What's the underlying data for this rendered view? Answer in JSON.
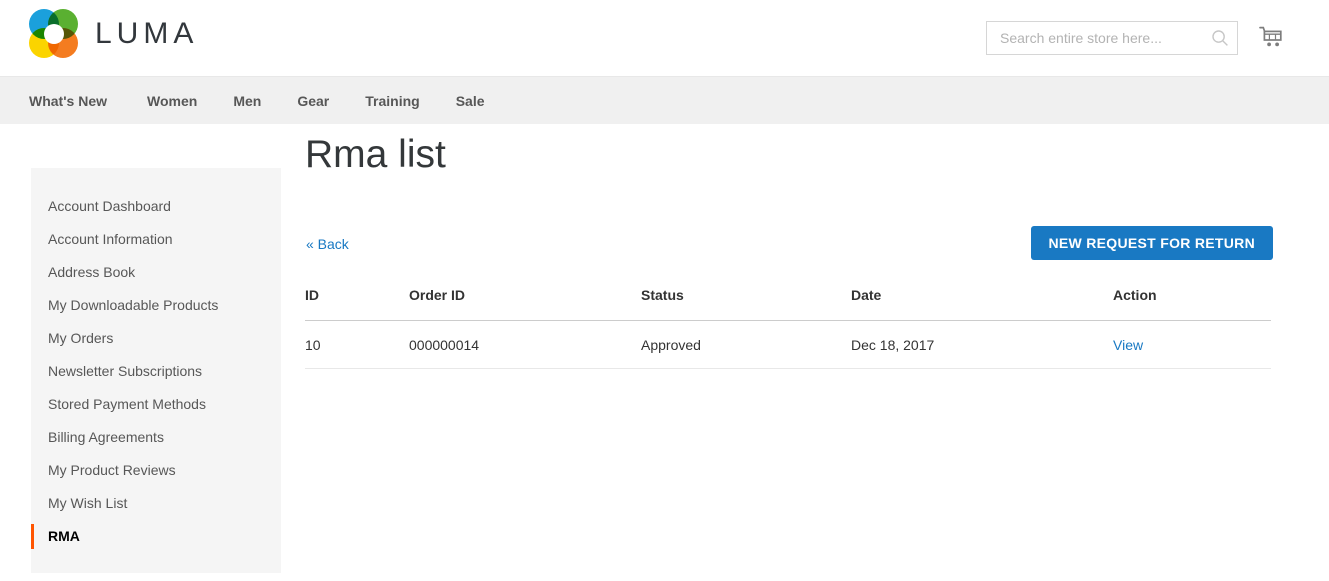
{
  "brand": {
    "name": "LUMA",
    "logo_icon": "luma-ring-logo",
    "logo_colors": {
      "top_left": "#1ba0dc",
      "top_right": "#5ab031",
      "bottom_left": "#fbd400",
      "bottom_right": "#f47c20"
    }
  },
  "header": {
    "search": {
      "placeholder": "Search entire store here...",
      "value": "",
      "icon": "search-icon"
    },
    "cart": {
      "icon": "shopping-cart-icon"
    }
  },
  "nav": {
    "items": [
      {
        "label": "What's New"
      },
      {
        "label": "Women"
      },
      {
        "label": "Men"
      },
      {
        "label": "Gear"
      },
      {
        "label": "Training"
      },
      {
        "label": "Sale"
      }
    ]
  },
  "sidebar": {
    "items": [
      {
        "label": "Account Dashboard",
        "current": false
      },
      {
        "label": "Account Information",
        "current": false
      },
      {
        "label": "Address Book",
        "current": false
      },
      {
        "label": "My Downloadable Products",
        "current": false
      },
      {
        "label": "My Orders",
        "current": false
      },
      {
        "label": "Newsletter Subscriptions",
        "current": false
      },
      {
        "label": "Stored Payment Methods",
        "current": false
      },
      {
        "label": "Billing Agreements",
        "current": false
      },
      {
        "label": "My Product Reviews",
        "current": false
      },
      {
        "label": "My Wish List",
        "current": false
      },
      {
        "label": "RMA",
        "current": true
      }
    ],
    "current_marker_color": "#ff5501"
  },
  "main": {
    "title": "Rma list",
    "back_link": "« Back",
    "new_request_button": "NEW REQUEST FOR RETURN",
    "accent_color": "#1979c3",
    "table": {
      "columns": [
        "ID",
        "Order ID",
        "Status",
        "Date",
        "Action"
      ],
      "rows": [
        {
          "id": "10",
          "order_id": "000000014",
          "status": "Approved",
          "date": "Dec 18, 2017",
          "action": "View"
        }
      ]
    }
  }
}
